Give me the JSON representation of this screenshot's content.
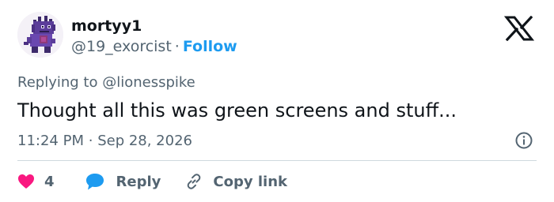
{
  "author": {
    "display_name": "mortyy1",
    "handle": "@19_exorcist",
    "separator": "·",
    "follow_label": "Follow",
    "avatar": "pixel-art-purple-creature"
  },
  "brand": {
    "logo": "x-logo-icon"
  },
  "reply_context": {
    "prefix": "Replying to",
    "mention": "@lionesspike"
  },
  "tweet": {
    "text": "Thought all this was green screens and stuff...",
    "time": "11:24 PM",
    "separator": "·",
    "date": "Sep 28, 2026"
  },
  "actions": {
    "like_icon": "heart-icon",
    "like_count": "4",
    "reply_icon": "speech-bubble-icon",
    "reply_label": "Reply",
    "copy_icon": "link-icon",
    "copy_label": "Copy link"
  },
  "colors": {
    "accent": "#1d9bf0",
    "like": "#f91880",
    "text": "#0f1419",
    "muted": "#536471",
    "divider": "#cfd9de"
  }
}
